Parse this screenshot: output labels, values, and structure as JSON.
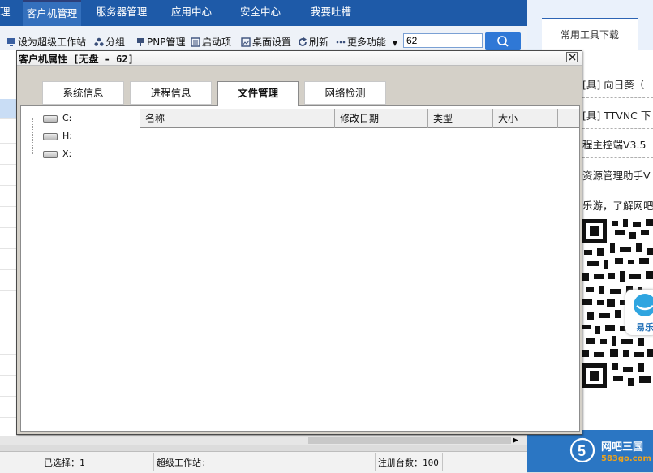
{
  "nav": {
    "tabs": [
      {
        "label": "理"
      },
      {
        "label": "客户机管理"
      },
      {
        "label": "服务器管理"
      },
      {
        "label": "应用中心"
      },
      {
        "label": "安全中心"
      },
      {
        "label": "我要吐槽"
      }
    ]
  },
  "toolbar": {
    "set_super": "设为超级工作站",
    "group": "分组",
    "pnp": "PNP管理",
    "startup": "启动项",
    "desktop": "桌面设置",
    "refresh": "刷新",
    "more": "更多功能",
    "search_value": "62"
  },
  "right_panel": {
    "tab": "常用工具下载",
    "lines": [
      "[具] 向日葵（",
      "[具] TTVNC 下",
      "程主控端V3.5",
      "资源管理助手V",
      "乐游，了解网吧"
    ],
    "yile_label": "易乐",
    "footer_title": "网吧三国",
    "footer_url": "583go.com"
  },
  "dialog": {
    "title": "客户机属性 [无盘 - 62]",
    "tabs": [
      {
        "label": "系统信息"
      },
      {
        "label": "进程信息"
      },
      {
        "label": "文件管理"
      },
      {
        "label": "网络检测"
      }
    ],
    "drives": [
      "C:",
      "H:",
      "X:"
    ],
    "columns": [
      "名称",
      "修改日期",
      "类型",
      "大小"
    ]
  },
  "status": {
    "selected": "已选择：1",
    "super_ws": "超级工作站:",
    "registered": "注册台数：100"
  },
  "colors": {
    "nav_bg": "#1e5aa8",
    "footer_bg": "#2b76c3",
    "dialog_bg": "#d4d0c8"
  }
}
